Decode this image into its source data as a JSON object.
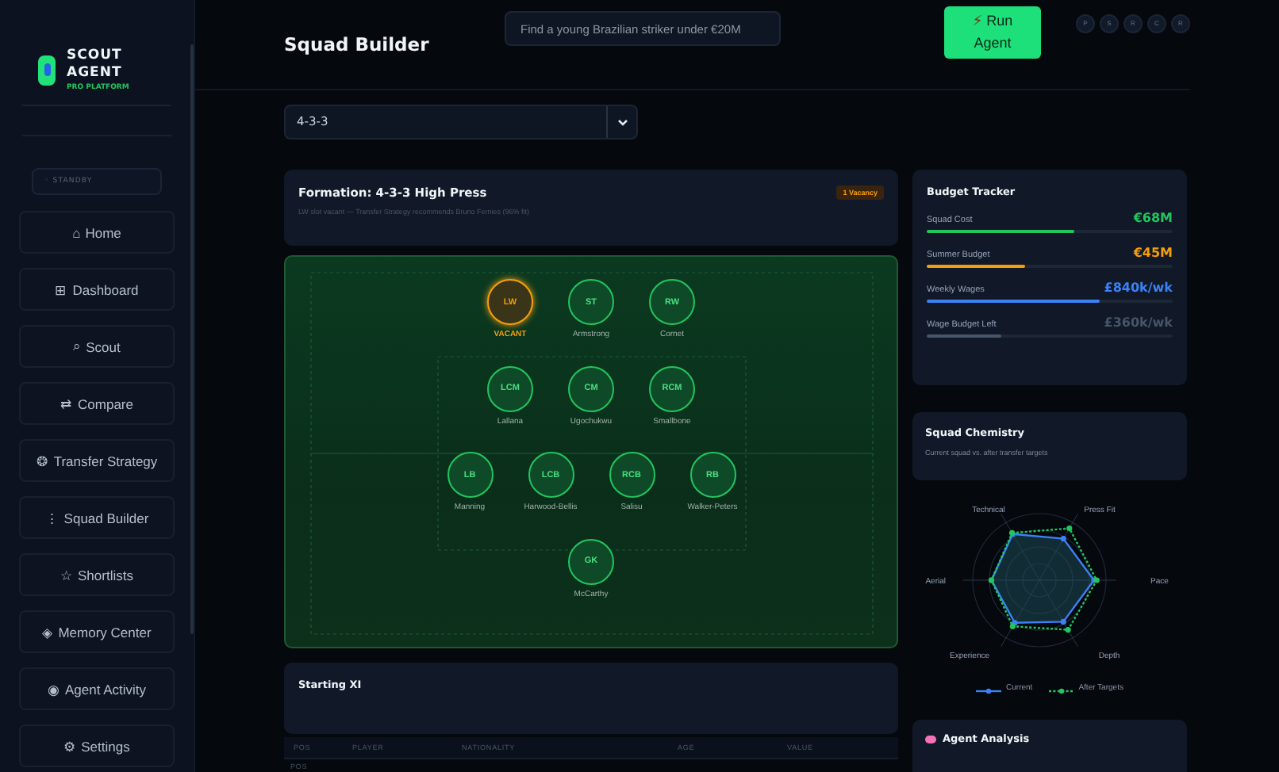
{
  "sidebar": {
    "brand": {
      "line_1": "SCOUT",
      "line_2": "AGENT",
      "tagline": "PRO PLATFORM"
    },
    "status": {
      "dot": "◦",
      "label": "STANDBY"
    },
    "items": [
      {
        "icon": "⌂",
        "label": "Home",
        "selected": false
      },
      {
        "icon": "⊞",
        "label": "Dashboard",
        "selected": false
      },
      {
        "icon": "⌕",
        "label": "Scout",
        "selected": false
      },
      {
        "icon": "⇄",
        "label": "Compare",
        "selected": false
      },
      {
        "icon": "❂",
        "label": "Transfer Strategy",
        "selected": false
      },
      {
        "icon": "⋮",
        "label": "Squad Builder",
        "selected": false
      },
      {
        "icon": "☆",
        "label": "Shortlists",
        "selected": false
      },
      {
        "icon": "◈",
        "label": "Memory Center",
        "selected": false
      },
      {
        "icon": "◉",
        "label": "Agent Activity",
        "selected": false
      },
      {
        "icon": "⚙",
        "label": "Settings",
        "selected": false
      }
    ]
  },
  "header": {
    "title": "Squad Builder",
    "search": {
      "placeholder": "Find a young Brazilian striker under €20M"
    },
    "run_button": {
      "icon": "⚡",
      "label": "Run Agent"
    },
    "avatars": [
      "P",
      "S",
      "R",
      "C",
      "R"
    ]
  },
  "formation_select": {
    "value": "4-3-3"
  },
  "formation": {
    "title": "Formation: 4-3-3 High Press",
    "badge": "1 Vacancy",
    "note": "LW slot vacant — Transfer Strategy recommends Bruno Fernies (96% fit)"
  },
  "pitch": {
    "rows": [
      {
        "players": [
          {
            "position": "LW",
            "name": "VACANT",
            "vacant": true
          },
          {
            "position": "ST",
            "name": "Armstrong",
            "vacant": false
          },
          {
            "position": "RW",
            "name": "Cornet",
            "vacant": false
          }
        ]
      },
      {
        "players": [
          {
            "position": "LCM",
            "name": "Lallana",
            "vacant": false
          },
          {
            "position": "CM",
            "name": "Ugochukwu",
            "vacant": false
          },
          {
            "position": "RCM",
            "name": "Smallbone",
            "vacant": false
          }
        ]
      },
      {
        "players": [
          {
            "position": "LB",
            "name": "Manning",
            "vacant": false
          },
          {
            "position": "LCB",
            "name": "Harwood-Bellis",
            "vacant": false
          },
          {
            "position": "RCB",
            "name": "Salisu",
            "vacant": false
          },
          {
            "position": "RB",
            "name": "Walker-Peters",
            "vacant": false
          }
        ]
      },
      {
        "players": [
          {
            "position": "GK",
            "name": "McCarthy",
            "vacant": false
          }
        ]
      }
    ]
  },
  "starting_xi": {
    "title": "Starting XI",
    "columns": [
      "POS",
      "PLAYER",
      "NATIONALITY",
      "AGE",
      "VALUE"
    ],
    "rows": [
      {
        "cells": [
          "POS"
        ]
      }
    ]
  },
  "budget": {
    "title": "Budget Tracker",
    "rows": [
      {
        "label": "Squad Cost",
        "value": "€68M",
        "level": 0.6,
        "color": "#22c55e"
      },
      {
        "label": "Summer Budget",
        "value": "€45M",
        "level": 0.4,
        "color": "#f59e0b"
      },
      {
        "label": "Weekly Wages",
        "value": "£840k/wk",
        "level": 0.7,
        "color": "#3b82f6"
      },
      {
        "label": "Wage Budget Left",
        "value": "£360k/wk",
        "level": 0.3,
        "color": "#475569"
      }
    ]
  },
  "chemistry": {
    "title": "Squad Chemistry",
    "subtitle": "Current squad vs. after transfer targets",
    "axes": [
      "Technical",
      "Press Fit",
      "Pace",
      "Depth",
      "Experience",
      "Aerial"
    ],
    "legend": [
      "Current",
      "After Targets"
    ]
  },
  "analysis": {
    "title": "Agent Analysis"
  }
}
